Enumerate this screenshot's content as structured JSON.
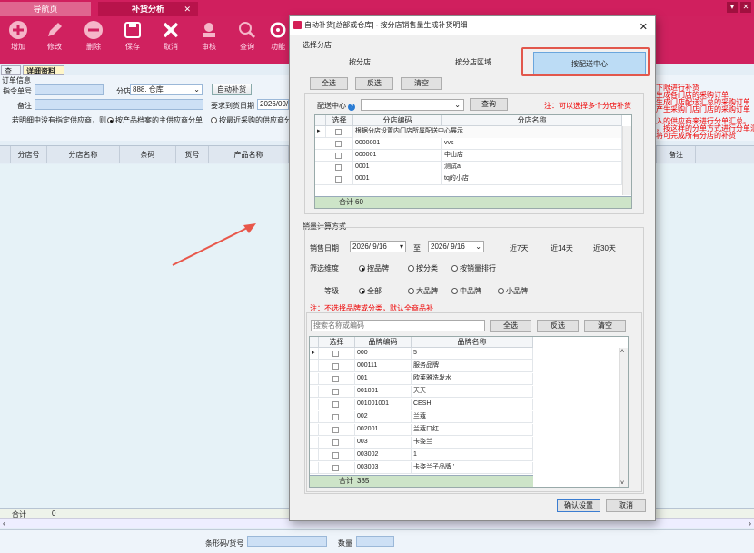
{
  "tabs": {
    "home": "导航页",
    "active": "补货分析"
  },
  "toolbar": [
    {
      "label": "增加",
      "icon": "add-icon"
    },
    {
      "label": "修改",
      "icon": "edit-icon"
    },
    {
      "label": "删除",
      "icon": "delete-icon"
    },
    {
      "label": "保存",
      "icon": "save-icon"
    },
    {
      "label": "取消",
      "icon": "cancel-icon"
    },
    {
      "label": "审核",
      "icon": "audit-icon"
    },
    {
      "label": "查询",
      "icon": "query-icon"
    },
    {
      "label": "功能",
      "icon": "gear-icon"
    }
  ],
  "subtabs": {
    "query": "查询",
    "detail": "详细资料"
  },
  "form": {
    "section": "订单信息",
    "order_no_label": "指令单号",
    "branch_label": "分店",
    "branch_value": "888. 仓库",
    "auto_btn": "自动补货",
    "remark_label": "备注",
    "req_date_label": "要求到货日期",
    "req_date_value": "2026/09/1",
    "supplier_note": "若明细中没有指定供应商，则",
    "opt_main_supplier": "按产品档案的主供应商分单",
    "opt_recent_supplier": "按最近采购的供应商分"
  },
  "grid_headers": [
    "分店号",
    "分店名称",
    "条码",
    "货号",
    "产品名称",
    "备注"
  ],
  "right_notes": [
    "下限进行补货",
    "生成各门店的采购订单",
    "生成门店配送汇总的采购订单",
    "产生采购门店门店的采购订单",
    "",
    "入的供应商来进行分单汇总。",
    "，按这样的分单方式进行分单汇总",
    "将可完成所有分店的补货"
  ],
  "bottom": {
    "total_label": "合计",
    "total_value": "0",
    "barcode_label": "条形码/货号",
    "qty_label": "数量"
  },
  "dialog": {
    "title": "自动补货[总部或仓库] - 按分店销售量生成补货明细",
    "section1": "选择分店",
    "seg1": "按分店",
    "seg2": "按分店区域",
    "seg3": "按配送中心",
    "btn_all": "全选",
    "btn_invert": "反选",
    "btn_clear": "清空",
    "dc_label": "配送中心",
    "query_btn": "查询",
    "multi_note": "注：可以选择多个分店补货",
    "tbl1_headers": [
      "选择",
      "分店编码",
      "分店名称"
    ],
    "tooltip": "根据分店设置内门店所属配送中心展示",
    "tbl1_rows": [
      {
        "code": "0000001",
        "name": "vvs"
      },
      {
        "code": "000001",
        "name": "中山店"
      },
      {
        "code": "0001",
        "name": "测试a"
      },
      {
        "code": "0001",
        "name": "tq的小店"
      }
    ],
    "tbl1_sum_label": "合计",
    "tbl1_sum_value": "60",
    "section2": "销量计算方式",
    "sales_date_label": "销售日期",
    "date_from": "2026/ 9/16",
    "date_to_label": "至",
    "date_to": "2026/ 9/16",
    "quick1": "近7天",
    "quick2": "近14天",
    "quick3": "近30天",
    "filter_label": "筛选维度",
    "filter_opts": [
      "按品牌",
      "按分类",
      "按销量排行"
    ],
    "level_label": "等级",
    "level_opts": [
      "全部",
      "大品牌",
      "中品牌",
      "小品牌"
    ],
    "brand_note": "注：不选择品牌或分类，默认全商品补",
    "search_placeholder": "搜索名称或编码",
    "btn2_all": "全选",
    "btn2_invert": "反选",
    "btn2_clear": "清空",
    "tbl2_headers": [
      "选择",
      "品牌编码",
      "品牌名称"
    ],
    "tbl2_rows": [
      {
        "code": "000",
        "name": "5"
      },
      {
        "code": "000111",
        "name": "服务品牌"
      },
      {
        "code": "001",
        "name": "欧莱雅洗发水"
      },
      {
        "code": "001001",
        "name": "天天"
      },
      {
        "code": "001001001",
        "name": "CESHI"
      },
      {
        "code": "002",
        "name": "兰蔻"
      },
      {
        "code": "002001",
        "name": "兰蔻口红"
      },
      {
        "code": "003",
        "name": "卡姿兰"
      },
      {
        "code": "003002",
        "name": "1"
      },
      {
        "code": "003003",
        "name": "卡姿兰子品牌 '"
      }
    ],
    "tbl2_sum_label": "合计",
    "tbl2_sum_value": "385",
    "confirm_btn": "确认设置",
    "cancel_btn": "取消"
  }
}
